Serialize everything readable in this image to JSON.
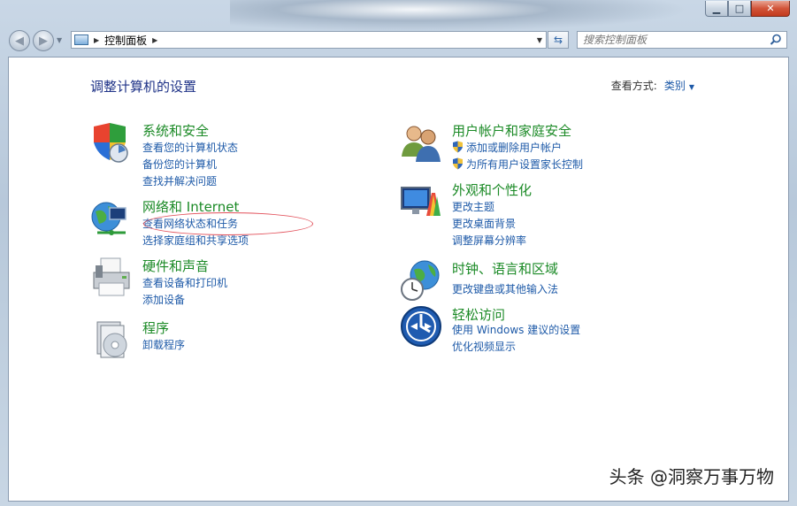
{
  "window": {
    "caption": {
      "minimize": "▁",
      "maximize": "□",
      "close": "✕"
    }
  },
  "nav": {
    "back_icon": "back-arrow-icon",
    "forward_icon": "forward-arrow-icon",
    "breadcrumb": [
      "控制面板"
    ],
    "search_placeholder": "搜索控制面板"
  },
  "header": {
    "title": "调整计算机的设置",
    "view_by_label": "查看方式:",
    "view_by_value": "类别"
  },
  "left_categories": [
    {
      "title": "系统和安全",
      "icon": "shield-icon",
      "links": [
        "查看您的计算机状态",
        "备份您的计算机",
        "查找并解决问题"
      ]
    },
    {
      "title": "网络和 Internet",
      "icon": "network-icon",
      "links": [
        "查看网络状态和任务",
        "选择家庭组和共享选项"
      ]
    },
    {
      "title": "硬件和声音",
      "icon": "printer-icon",
      "links": [
        "查看设备和打印机",
        "添加设备"
      ]
    },
    {
      "title": "程序",
      "icon": "programs-icon",
      "links": [
        "卸载程序"
      ]
    }
  ],
  "right_categories": [
    {
      "title": "用户帐户和家庭安全",
      "icon": "users-icon",
      "links": [
        "添加或删除用户帐户",
        "为所有用户设置家长控制"
      ]
    },
    {
      "title": "外观和个性化",
      "icon": "appearance-icon",
      "links": [
        "更改主题",
        "更改桌面背景",
        "调整屏幕分辨率"
      ]
    },
    {
      "title": "时钟、语言和区域",
      "icon": "clock-globe-icon",
      "links": [
        "更改键盘或其他输入法"
      ]
    },
    {
      "title": "轻松访问",
      "icon": "ease-of-access-icon",
      "links": [
        "使用 Windows 建议的设置",
        "优化视频显示"
      ]
    }
  ],
  "watermark": "头条 @洞察万事万物",
  "colors": {
    "title_green": "#1b8a26",
    "link_blue": "#1e5aa8",
    "heading_blue": "#1e3287",
    "annotation_red": "#e2505a"
  }
}
